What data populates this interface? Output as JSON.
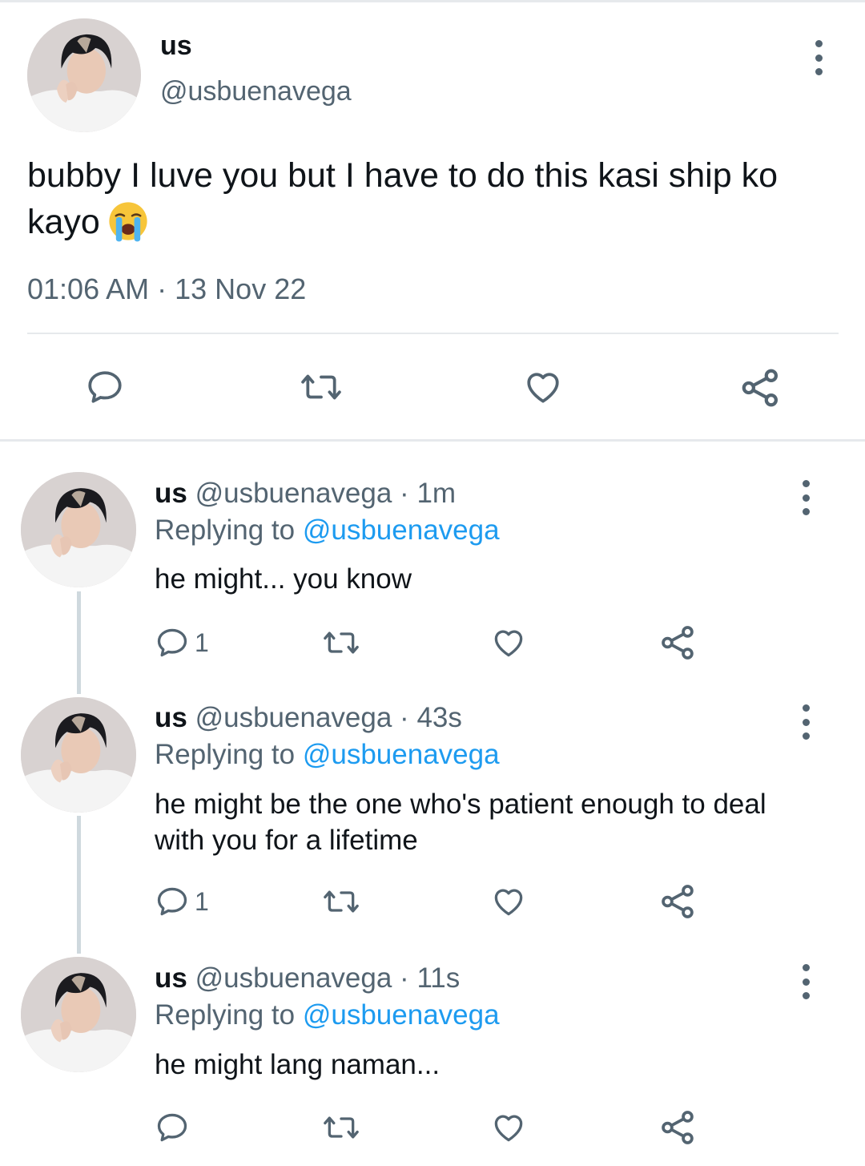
{
  "main": {
    "name": "us",
    "handle": "@usbuenavega",
    "text": "bubby I luve you but I have to do this kasi ship ko kayo",
    "emoji": "loudly-crying-face",
    "time": "01:06 AM",
    "date_sep": "·",
    "date": "13 Nov 22"
  },
  "replies": [
    {
      "name": "us",
      "handle": "@usbuenavega",
      "sep": "·",
      "age": "1m",
      "replying_prefix": "Replying to",
      "replying_handle": "@usbuenavega",
      "text": "he might... you know",
      "reply_count": "1"
    },
    {
      "name": "us",
      "handle": "@usbuenavega",
      "sep": "·",
      "age": "43s",
      "replying_prefix": "Replying to",
      "replying_handle": "@usbuenavega",
      "text": "he might be the one who's patient enough to deal with you for a lifetime",
      "reply_count": "1"
    },
    {
      "name": "us",
      "handle": "@usbuenavega",
      "sep": "·",
      "age": "11s",
      "replying_prefix": "Replying to",
      "replying_handle": "@usbuenavega",
      "text": "he might lang naman...",
      "reply_count": ""
    }
  ],
  "icons": {
    "reply": "reply-icon",
    "retweet": "retweet-icon",
    "like": "heart-icon",
    "share": "share-icon",
    "more": "more-options-icon"
  },
  "colors": {
    "text": "#0f1419",
    "muted": "#536471",
    "link": "#1d9bf0",
    "divider": "#e6e9ec",
    "thread_line": "#cfd9de"
  }
}
